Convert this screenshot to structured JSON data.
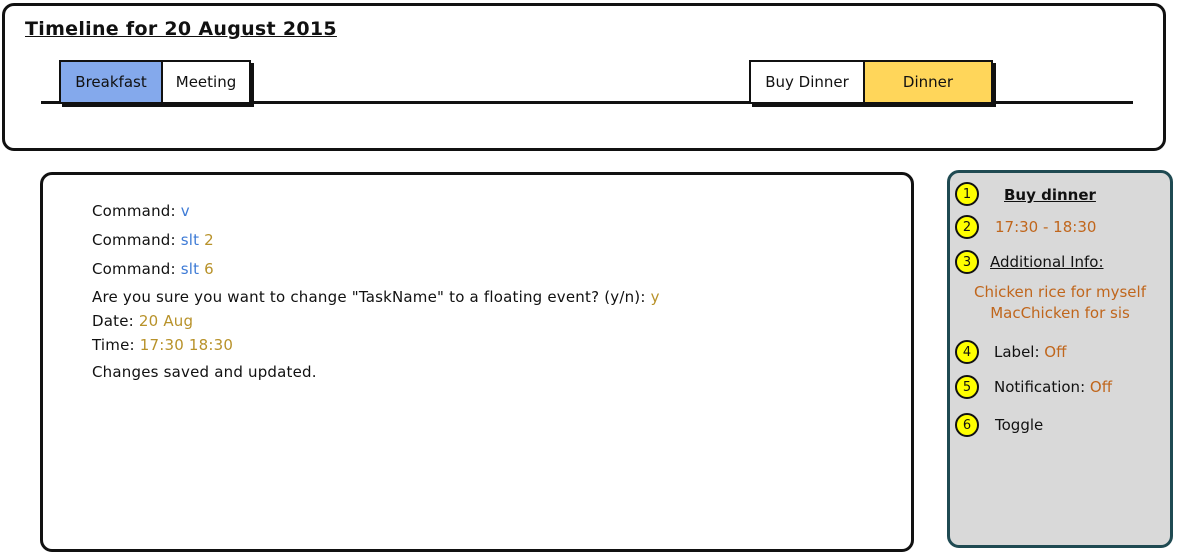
{
  "timeline": {
    "title": "Timeline for 20 August 2015",
    "events": [
      "Breakfast",
      "Meeting",
      "Buy Dinner",
      "Dinner"
    ],
    "colors": {
      "breakfast": "#84a9ec",
      "dinner": "#ffd65a"
    }
  },
  "console": {
    "lines": [
      {
        "prefix": "Command: ",
        "parts": [
          "v"
        ]
      },
      {
        "prefix": "Command: ",
        "parts": [
          "slt",
          "2"
        ]
      },
      {
        "prefix": "Command: ",
        "parts": [
          "slt",
          "6"
        ]
      },
      {
        "prefix": "Are you sure you want to change \"TaskName\" to a floating event? (y/n): ",
        "parts": [
          "y"
        ]
      },
      {
        "prefix": "Date: ",
        "parts": [
          "20 Aug"
        ]
      },
      {
        "prefix": "Time: ",
        "parts": [
          "17:30 18:30"
        ]
      },
      {
        "prefix": "Changes saved and updated.",
        "parts": []
      }
    ]
  },
  "details": {
    "badges": [
      "1",
      "2",
      "3",
      "4",
      "5",
      "6"
    ],
    "title": "Buy dinner",
    "time": "17:30 - 18:30",
    "additional_label": "Additional Info:",
    "info_line1": "Chicken rice for myself",
    "info_line2": "MacChicken for sis",
    "label_key": "Label: ",
    "label_value": "Off",
    "notification_key": "Notification: ",
    "notification_value": "Off",
    "toggle": "Toggle"
  }
}
